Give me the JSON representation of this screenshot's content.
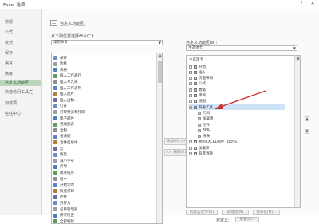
{
  "window": {
    "title": "Excel 选项",
    "help": "?",
    "close": "✕"
  },
  "sidebar": {
    "items": [
      {
        "label": "常规"
      },
      {
        "label": "公式"
      },
      {
        "label": "校对"
      },
      {
        "label": "保存"
      },
      {
        "label": "语言"
      },
      {
        "label": "高级"
      },
      {
        "label": "自定义功能区",
        "active": true
      },
      {
        "label": "快速访问工具栏"
      },
      {
        "label": "加载项"
      },
      {
        "label": "信任中心"
      }
    ]
  },
  "header": {
    "title": "自定义功能区。"
  },
  "left": {
    "label": "从下列位置选择命令(C):",
    "select_value": "常用命令",
    "commands": [
      "保存",
      "边框",
      "表格",
      "插入工作表行",
      "插入单元格",
      "插入工作表列",
      "插入图片",
      "插入函数...",
      "打开",
      "打印预览和打印",
      "电子邮件",
      "活动图表",
      "复制",
      "格式刷",
      "合并后居中",
      "宏",
      "恢复",
      "减小字号",
      "剪切",
      "降序排序",
      "居中",
      "开始计时",
      "快速打印",
      "连接",
      "另存为",
      "名称管理器",
      "拼写检查",
      "全部刷新"
    ]
  },
  "middle": {
    "add_label": "添加(A) >>",
    "remove_label": "<< 删除(R)"
  },
  "right": {
    "label": "自定义功能区(B):",
    "select_value": "主选项卡",
    "list_header": "主选项卡",
    "tree": [
      {
        "label": "开始",
        "expand": "+"
      },
      {
        "label": "插入",
        "expand": "+"
      },
      {
        "label": "页面布局",
        "expand": "+"
      },
      {
        "label": "公式",
        "expand": "+"
      },
      {
        "label": "数据",
        "expand": "+"
      },
      {
        "label": "审阅",
        "expand": "+"
      },
      {
        "label": "视图",
        "expand": "+"
      },
      {
        "label": "开发工具",
        "expand": "−",
        "selected": true
      },
      {
        "label": "代码",
        "expand": "+",
        "indent": true
      },
      {
        "label": "加载项",
        "expand": "+",
        "indent": true
      },
      {
        "label": "控件",
        "expand": "+",
        "indent": true
      },
      {
        "label": "XML",
        "expand": "+",
        "indent": true
      },
      {
        "label": "修改",
        "expand": "+",
        "indent": true
      },
      {
        "label": "我的EXCEL插件 (自定义)",
        "expand": "+"
      },
      {
        "label": "加载项",
        "expand": "+"
      },
      {
        "label": "背景消除",
        "expand": "+"
      }
    ],
    "new_tab_label": "新建选项卡(W)",
    "new_group_label": "新建组(N)",
    "rename_label": "重命名(M)...",
    "custom_label": "自定义:",
    "reset_label": "重置(E) ▾"
  },
  "colors": {
    "accent": "#bcd6bc",
    "selection": "#cfe3f7",
    "annotation_arrow": "#d32f2f"
  }
}
